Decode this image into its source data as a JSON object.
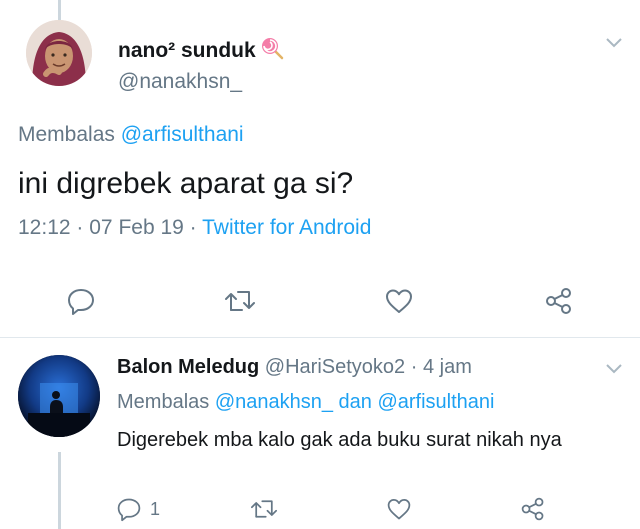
{
  "main_tweet": {
    "display_name": "nano² sunduk",
    "name_emoji": "lollipop-icon",
    "handle": "@nanakhsn_",
    "replying_label": "Membalas",
    "replying_mention": "@arfisulthani",
    "text": "ini digrebek aparat ga si?",
    "time": "12:12",
    "date": "07 Feb 19",
    "source": "Twitter for Android",
    "dot": "·",
    "actions": [
      "reply-icon",
      "retweet-icon",
      "like-icon",
      "share-icon"
    ]
  },
  "reply_tweet": {
    "display_name": "Balon Meledug",
    "handle": "@HariSetyoko2",
    "age": "4 jam",
    "dot": "·",
    "replying_label": "Membalas",
    "replying_mentions": "@nanakhsn_ dan @arfisulthani",
    "text": "Digerebek mba kalo gak ada buku surat nikah nya",
    "reply_count": "1"
  },
  "colors": {
    "accent": "#1da1f2",
    "muted": "#657786",
    "text": "#14171a",
    "divider": "#e1e8ed"
  }
}
